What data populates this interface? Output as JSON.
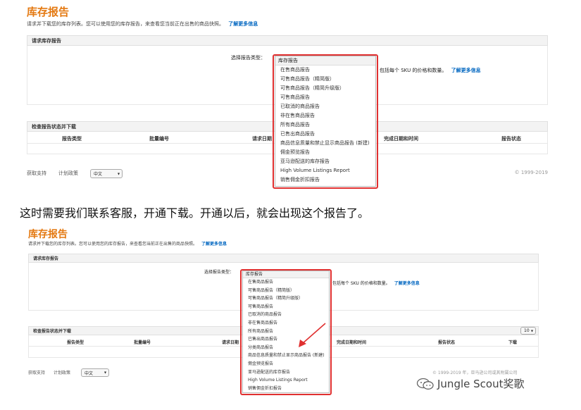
{
  "shot1": {
    "title": "库存报告",
    "description": "请求并下载您的库存列表。您可以使用您的库存报告，来查看您当前正在出售的商品快照。",
    "learn_more": "了解更多信息",
    "request_section": "请求库存报告",
    "select_label": "选择报告类型：",
    "right_text": "包括每个 SKU 的价格和数量。",
    "right_link": "了解更多信息",
    "status_section": "检查报告状态并下载",
    "columns": [
      "报告类型",
      "批量编号",
      "请求日期",
      "完成日期和时间",
      "报告状态"
    ],
    "footer": {
      "support": "获取支持",
      "policy": "计划政策",
      "language": "中文",
      "copyright": "© 1999-2019"
    },
    "dropdown": {
      "header": "库存报告",
      "options": [
        "在售商品报告",
        "可售商品报告（精简版）",
        "可售商品报告（精简升级版）",
        "可售商品报告",
        "已取消的商品报告",
        "非在售商品报告",
        "所有商品报告",
        "已售出商品报告",
        "商品信息质量和禁止显示商品报告 (新建)",
        "佣金预览报告",
        "亚马逊配送的库存报告",
        "High Volume Listings Report",
        "销售佣金折扣报告"
      ]
    }
  },
  "caption": "这时需要我们联系客服，开通下载。开通以后，就会出现这个报告了。",
  "shot2": {
    "title": "库存报告",
    "description": "请求并下载您的库存列表。您可以使用您的库存报告，来查看您当前正在出售的商品快照。",
    "learn_more": "了解更多信息",
    "request_section": "请求库存报告",
    "select_label": "选择报告类型：",
    "right_text": "包括每个 SKU 的价格和数量。",
    "right_link": "了解更多信息",
    "status_section": "检查报告状态并下载",
    "page_size": "10",
    "columns": [
      "报告类型",
      "批量编号",
      "请求日期",
      "完成日期和时间",
      "报告状态",
      "下载"
    ],
    "footer": {
      "support": "获取支持",
      "policy": "计划政策",
      "language": "中文",
      "copyright": "© 1999-2019 年，亚马逊公司或其附属公司"
    },
    "dropdown": {
      "header": "库存报告",
      "options": [
        "在售商品报告",
        "可售商品报告（精简版）",
        "可售商品报告（精简升级版）",
        "可售商品报告",
        "已取消的商品报告",
        "非在售商品报告",
        "所有商品报告",
        "已售出商品报告",
        "分类商品报告",
        "商品信息质量和禁止显示商品报告 (新建)",
        "佣金预览报告",
        "亚马逊配送的库存报告",
        "High Volume Listings Report",
        "销售佣金折扣报告"
      ]
    }
  },
  "watermark": "Jungle Scout奖歌",
  "colors": {
    "title": "#e47911",
    "link": "#0066c0",
    "highlight_box": "#e03030",
    "arrow": "#e03030"
  }
}
